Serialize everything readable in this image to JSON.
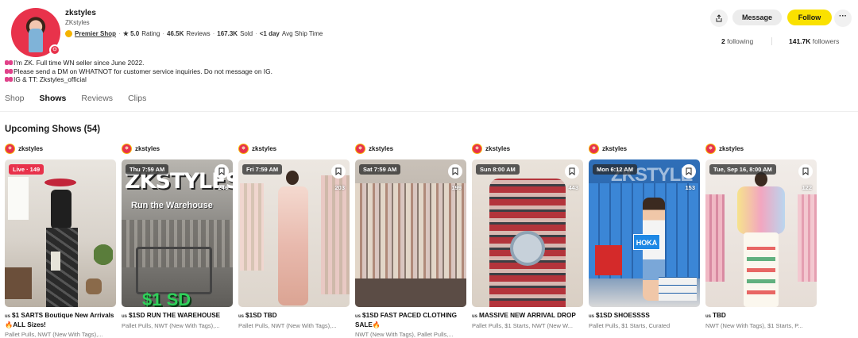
{
  "profile": {
    "username": "zkstyles",
    "display_name": "ZKstyles",
    "shop_tier": "Premier Shop",
    "rating_value": "★ 5.0",
    "rating_label": "Rating",
    "reviews_value": "46.5K",
    "reviews_label": "Reviews",
    "sold_value": "167.3K",
    "sold_label": "Sold",
    "ship_value": "<1 day",
    "ship_label": "Avg Ship Time",
    "bio": [
      "I'm ZK. Full time WN seller since June 2022.",
      "Please send a DM on WHATNOT for customer service inquiries. Do not message on IG.",
      "IG & TT: Zkstyles_official"
    ],
    "following_count": "2",
    "following_label": "following",
    "followers_count": "141.7K",
    "followers_label": "followers"
  },
  "actions": {
    "message": "Message",
    "follow": "Follow",
    "more": "···"
  },
  "tabs": [
    {
      "label": "Shop"
    },
    {
      "label": "Shows"
    },
    {
      "label": "Reviews"
    },
    {
      "label": "Clips"
    }
  ],
  "section": {
    "title": "Upcoming Shows (54)"
  },
  "shows": [
    {
      "host": "zkstyles",
      "badge": "Live · 149",
      "count": "",
      "title": "$1 SARTS Boutique New Arrivals🔥ALL Sizes!",
      "subtitle": "Pallet Pulls, NWT (New With Tags),..."
    },
    {
      "host": "zkstyles",
      "badge": "Thu 7:59 AM",
      "count": "246",
      "title": "$1SD RUN THE WAREHOUSE",
      "subtitle": "Pallet Pulls, NWT (New With Tags),...",
      "overlay_big": "ZKSTYLES",
      "overlay_mid": "Run the Warehouse",
      "overlay_bottom": "$1 SD"
    },
    {
      "host": "zkstyles",
      "badge": "Fri 7:59 AM",
      "count": "203",
      "title": "$1SD TBD",
      "subtitle": "Pallet Pulls, NWT (New With Tags),..."
    },
    {
      "host": "zkstyles",
      "badge": "Sat 7:59 AM",
      "count": "199",
      "title": "$1SD FAST PACED CLOTHING SALE🔥",
      "subtitle": "NWT (New With Tags), Pallet Pulls,..."
    },
    {
      "host": "zkstyles",
      "badge": "Sun 8:00 AM",
      "count": "443",
      "title": "MASSIVE NEW ARRIVAL DROP",
      "subtitle": "Pallet Pulls, $1 Starts, NWT (New W..."
    },
    {
      "host": "zkstyles",
      "badge": "Mon 6:12 AM",
      "count": "153",
      "title": "$1SD SHOESSSS",
      "subtitle": "Pallet Pulls, $1 Starts, Curated",
      "overlay_big": "ZKSTYLE",
      "overlay_box": "HOKA"
    },
    {
      "host": "zkstyles",
      "badge": "Tue, Sep 16, 8:00 AM",
      "count": "122",
      "title": "TBD",
      "subtitle": "NWT (New With Tags), $1 Starts, P..."
    }
  ],
  "flag_prefix": "us",
  "colors": {
    "follow": "#fae100",
    "live": "#e8324b",
    "avatar_bg": "#e8324b"
  },
  "icons": [
    "share-icon",
    "more-icon",
    "bookmark-icon",
    "premier-shop-icon",
    "bow-icon"
  ]
}
